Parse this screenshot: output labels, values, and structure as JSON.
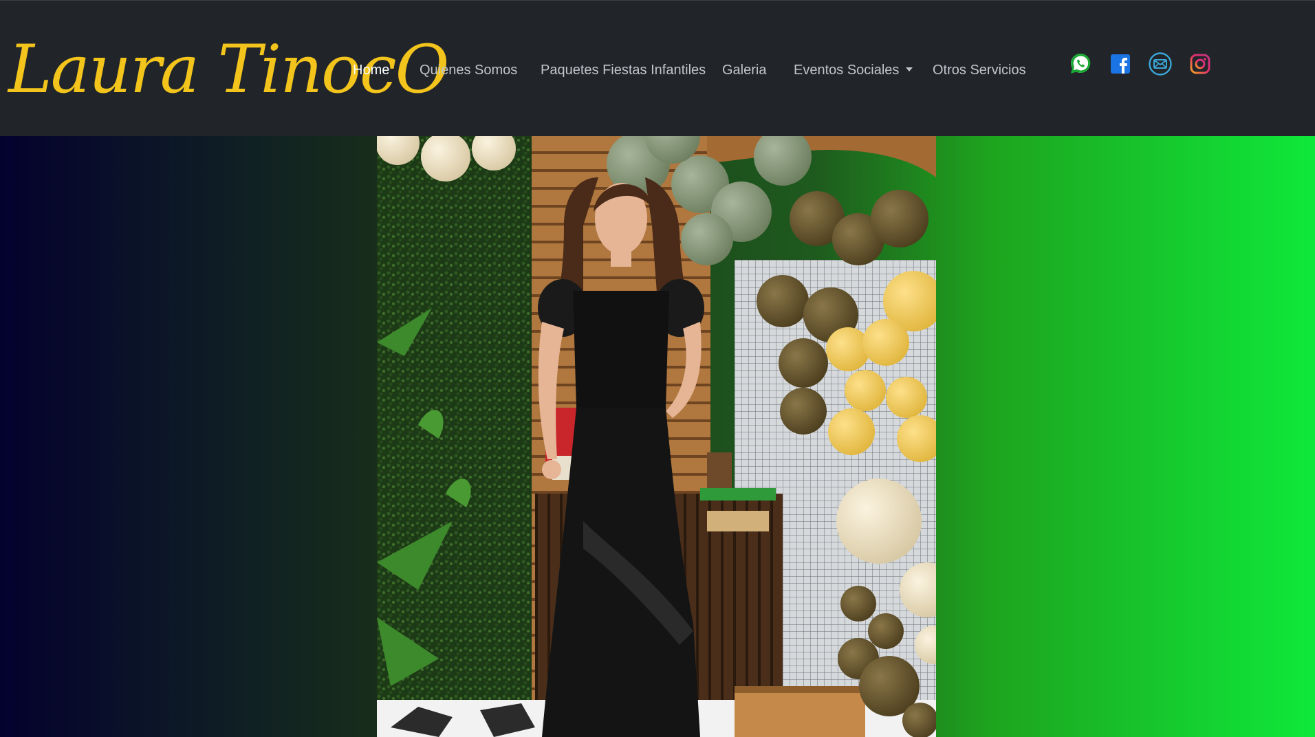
{
  "brand": {
    "name": "Laura TinocO"
  },
  "nav": {
    "items": [
      {
        "label": "Home",
        "active": true
      },
      {
        "label": "Quienes Somos"
      },
      {
        "label": "Paquetes Fiestas Infantiles"
      },
      {
        "label": "Galeria"
      },
      {
        "label": "Eventos Sociales",
        "dropdown": true
      },
      {
        "label": "Otros Servicios"
      }
    ]
  },
  "social": [
    {
      "icon": "whatsapp-icon",
      "color": "#1aa832"
    },
    {
      "icon": "facebook-icon",
      "color": "#1b74e4"
    },
    {
      "icon": "email-icon",
      "color": "#3aa7d8"
    },
    {
      "icon": "instagram-icon",
      "color": "#e1306c"
    }
  ],
  "colors": {
    "navbar_bg": "#212529",
    "brand": "#f2c41c",
    "nav_text": "#c2c6cb",
    "nav_active": "#ffffff"
  }
}
